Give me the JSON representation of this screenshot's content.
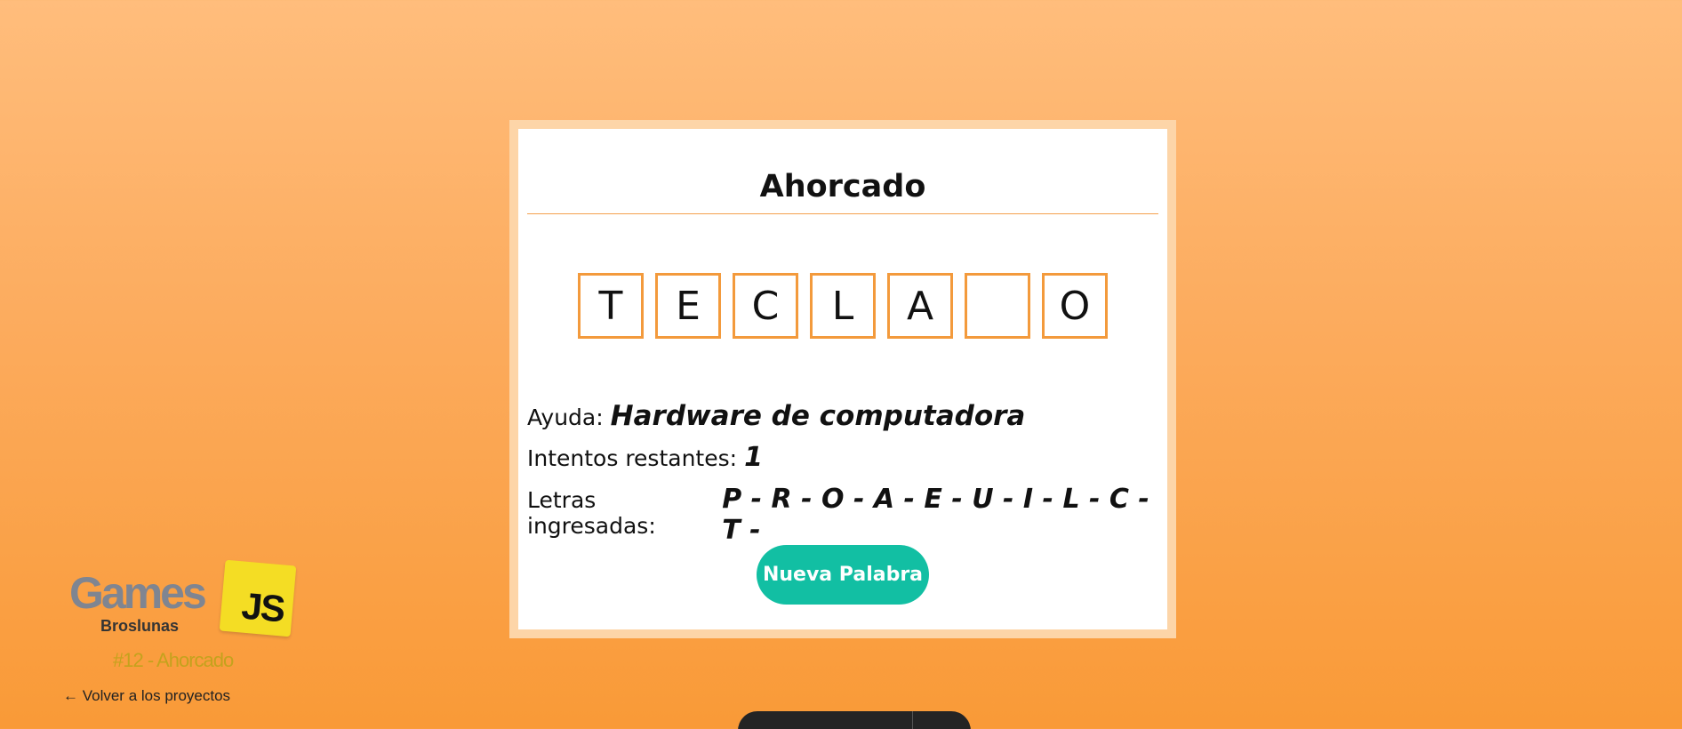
{
  "game": {
    "title": "Ahorcado",
    "letters": [
      "T",
      "E",
      "C",
      "L",
      "A",
      "",
      "O"
    ],
    "hint_label": "Ayuda:",
    "hint_value": "Hardware de computadora",
    "attempts_label": "Intentos restantes:",
    "attempts_value": "1",
    "entered_label": "Letras ingresadas:",
    "entered_value": "P - R - O - A - E - U - I - L - C - T -",
    "new_word_button": "Nueva Palabra"
  },
  "brand": {
    "games": "Games",
    "sub": "Broslunas",
    "badge": "JS",
    "project": "#12 - Ahorcado",
    "back_link": "← Volver a los proyectos"
  },
  "colors": {
    "accent_orange": "#f39a3c",
    "button_teal": "#12bfa3",
    "badge_yellow": "#f4dd24"
  }
}
